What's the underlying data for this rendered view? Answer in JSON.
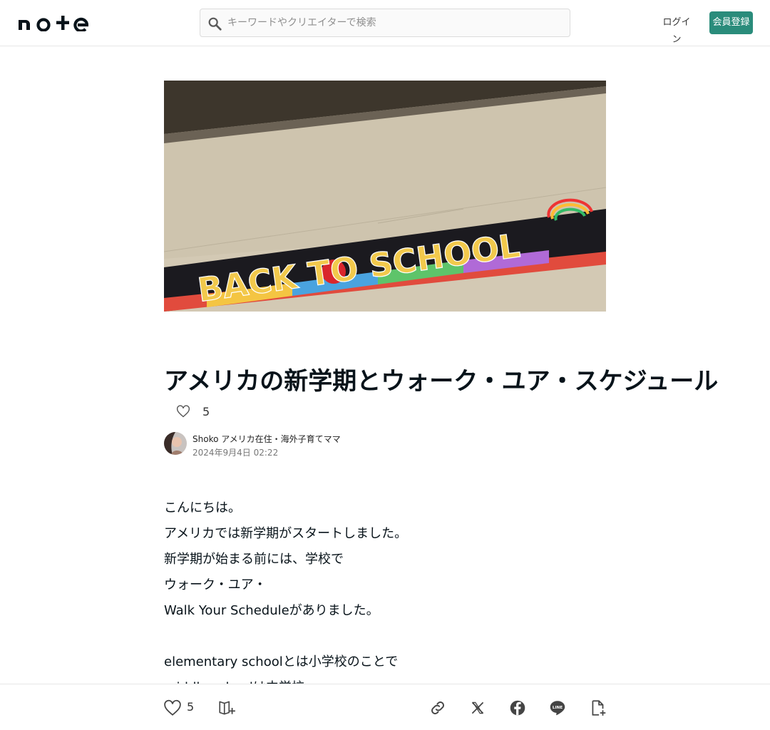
{
  "header": {
    "logo_alt": "note",
    "search_placeholder": "キーワードやクリエイターで検索",
    "login_label": "ログイン",
    "signup_label": "会員登録"
  },
  "hero": {
    "banner_text": "BACK TO SCHOOL"
  },
  "article": {
    "title": "アメリカの新学期とウォーク・ユア・スケジュール",
    "like_count": "5",
    "author": "Shoko アメリカ在住・海外子育てママ",
    "date": "2024年9月4日 02:22",
    "paragraphs": [
      "こんにちは。",
      "アメリカでは新学期がスタートしました。",
      "新学期が始まる前には、学校で",
      "ウォーク・ユア・",
      "Walk Your Scheduleがありました。",
      "",
      "elementary schoolとは小学校のことで",
      "middle schoolは中学校"
    ]
  },
  "bottom_bar": {
    "like_count": "5"
  },
  "colors": {
    "brand_green": "#2a8c7b",
    "text": "#08131a"
  }
}
